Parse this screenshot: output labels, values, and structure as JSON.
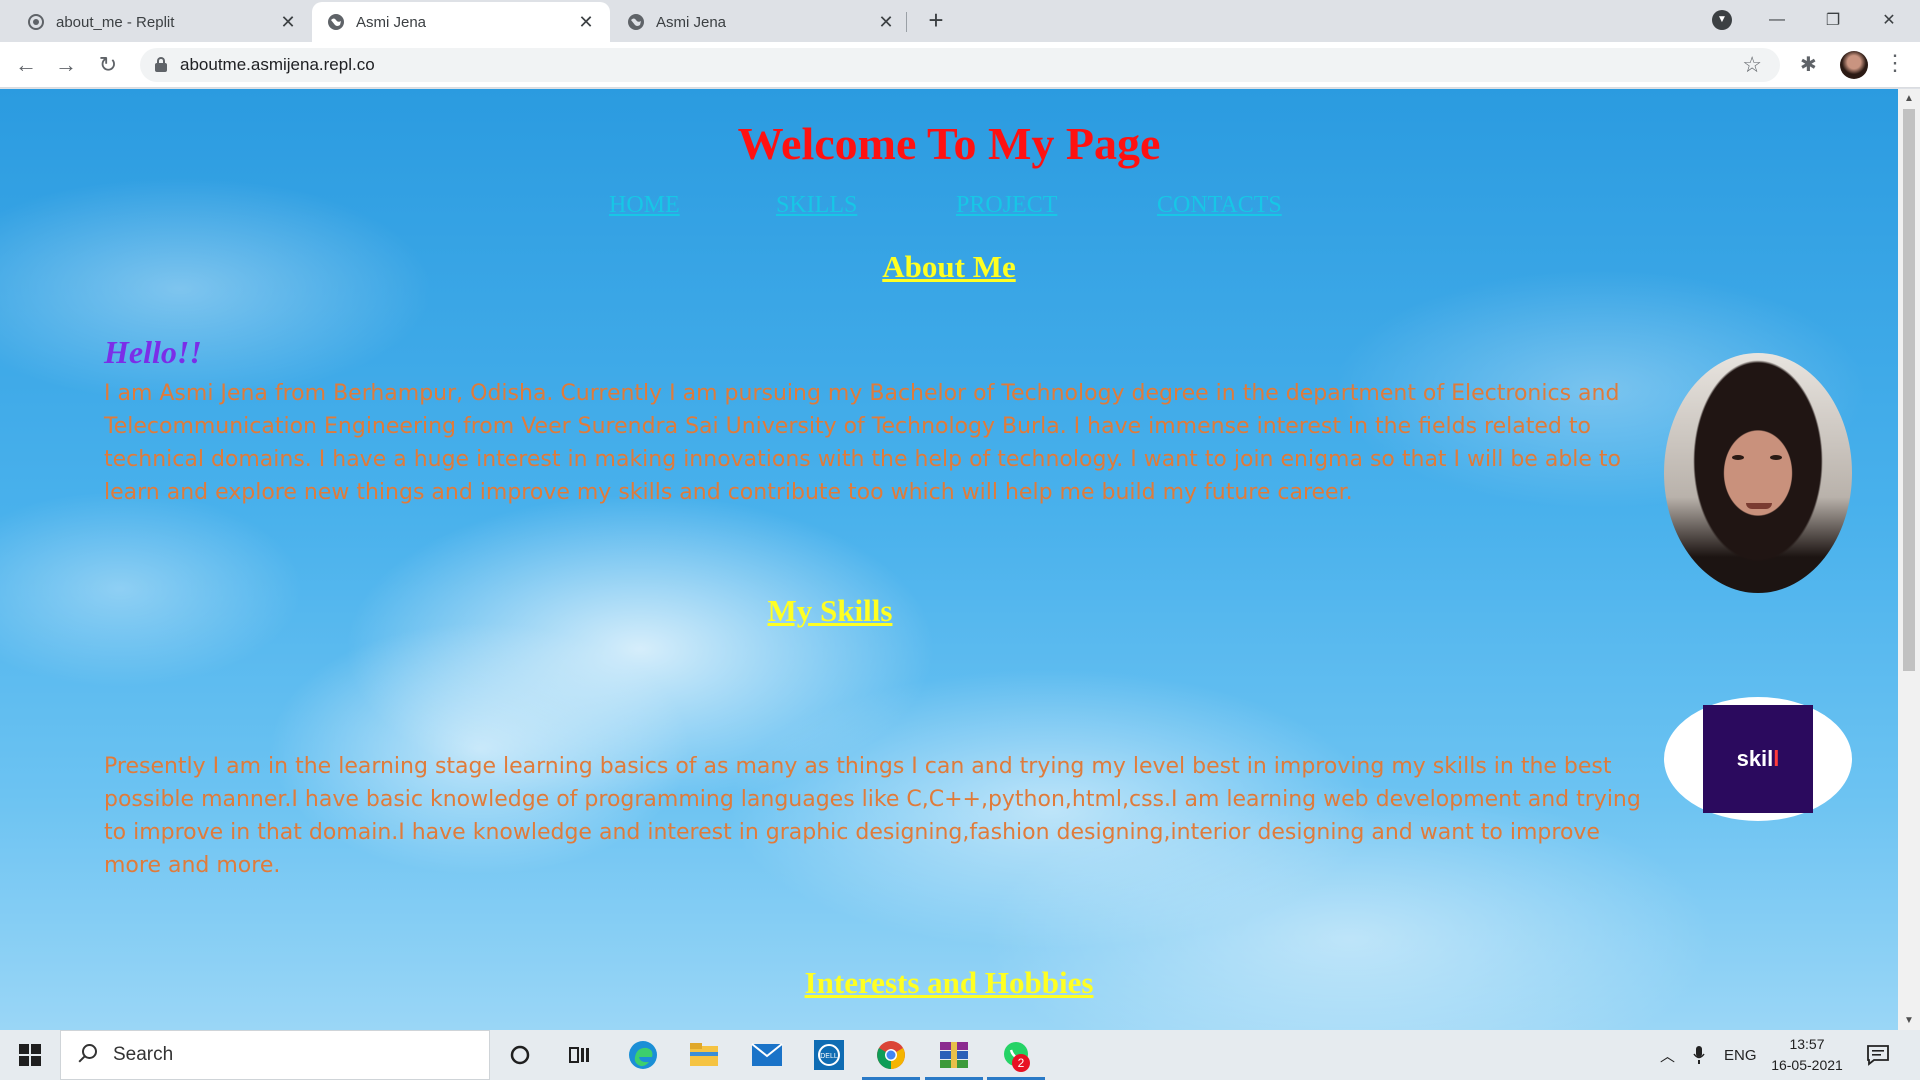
{
  "browser": {
    "tabs": [
      {
        "title": "about_me - Replit",
        "active": false,
        "favicon": "replit-icon"
      },
      {
        "title": "Asmi Jena",
        "active": true,
        "favicon": "globe-icon"
      },
      {
        "title": "Asmi Jena",
        "active": false,
        "favicon": "globe-icon"
      }
    ],
    "url": "aboutme.asmijena.repl.co"
  },
  "page": {
    "title": "Welcome To My Page",
    "nav": [
      "HOME",
      "SKILLS",
      "PROJECT",
      "CONTACTS"
    ],
    "about_heading": "About Me",
    "hello": "Hello!!",
    "about_text": "I am Asmi Jena from Berhampur, Odisha. Currently I am pursuing my Bachelor of Technology degree in the department of Electronics and Telecommunication Engineering from Veer Surendra Sai University of Technology Burla. I have immense interest in the fields related to technical domains. I have a huge interest in making innovations with the help of technology. I want to join enigma so that I will be able to learn and explore new things and improve my skills and contribute too which will help me build my future career.",
    "skills_heading": "My Skills",
    "skills_text": "Presently I am in the learning stage learning basics of as many as things I can and trying my level best in improving my skills in the best possible manner.I have basic knowledge of programming languages like C,C++,python,html,css.I am learning web development and trying to improve in that domain.I have knowledge and interest in graphic designing,fashion designing,interior designing and want to improve more and more.",
    "skill_logo_text": "skil",
    "skill_logo_accent": "l",
    "interests_heading": "Interests and Hobbies"
  },
  "colors": {
    "title": "#ff1111",
    "nav_link": "#17c7e6",
    "section_heading": "#ffff22",
    "hello": "#7b2ee8",
    "paragraph": "#e07b3a",
    "sky": "#49b1ec"
  },
  "taskbar": {
    "search_placeholder": "Search",
    "pinned": [
      "cortana-icon",
      "task-view-icon",
      "edge-icon",
      "file-explorer-icon",
      "mail-icon",
      "dell-icon",
      "chrome-icon",
      "winrar-icon",
      "whatsapp-icon"
    ],
    "whatsapp_badge": "2",
    "language": "ENG",
    "time": "13:57",
    "date": "16-05-2021"
  }
}
